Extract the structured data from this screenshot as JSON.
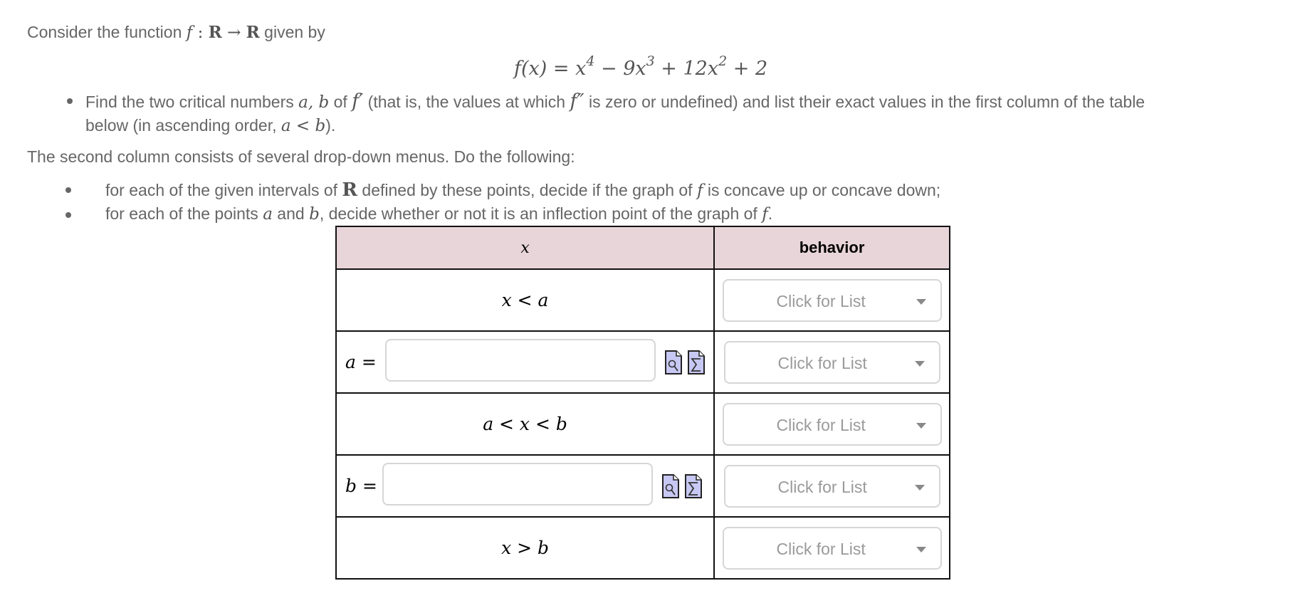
{
  "intro": {
    "prefix": "Consider the function ",
    "f": "f",
    "colon": " : ",
    "R1": "R",
    "arrow": " → ",
    "R2": "R",
    "suffix": " given by"
  },
  "formula": {
    "lhs": "f(x) = x",
    "exp1": "4",
    "t2": " − 9x",
    "exp2": "3",
    "t3": " + 12x",
    "exp3": "2",
    "t4": " + 2"
  },
  "bullet1": {
    "line1_a": "Find the two critical numbers ",
    "ab": "a, b",
    "line1_b": " of ",
    "fprime": "f′",
    "line1_c": " (that is, the values at which ",
    "fdprime": "f″",
    "line1_d": " is zero or undefined) and list their exact values in the first column of the table",
    "line2_a": "below (in ascending order, ",
    "altb": "a < b",
    "line2_b": ")."
  },
  "second_para": "The second column consists of several drop-down menus.  Do the following:",
  "bullet2": {
    "a": "for each of the given intervals of ",
    "R": "R",
    "b": " defined by these points, decide if the graph of ",
    "f": "f",
    "c": " is concave up or concave down;"
  },
  "bullet3": {
    "a": "for each of the points ",
    "pa": "a",
    "b": " and ",
    "pb": "b",
    "c": ", decide whether or not it is an inflection point of the graph of ",
    "f": "f",
    "d": "."
  },
  "table": {
    "headers": [
      "x",
      "behavior"
    ],
    "rows": [
      {
        "type": "interval",
        "label": "x < a",
        "dropdown": "Click for List"
      },
      {
        "type": "input",
        "label": "a =",
        "value": "",
        "dropdown": "Click for List"
      },
      {
        "type": "interval",
        "label": "a < x < b",
        "dropdown": "Click for List"
      },
      {
        "type": "input",
        "label": "b =",
        "value": "",
        "dropdown": "Click for List"
      },
      {
        "type": "interval",
        "label": "x > b",
        "dropdown": "Click for List"
      }
    ]
  },
  "icons": {
    "preview": "preview-document-icon",
    "equation": "equation-editor-icon",
    "icon_fill": "#c8c8f4"
  }
}
